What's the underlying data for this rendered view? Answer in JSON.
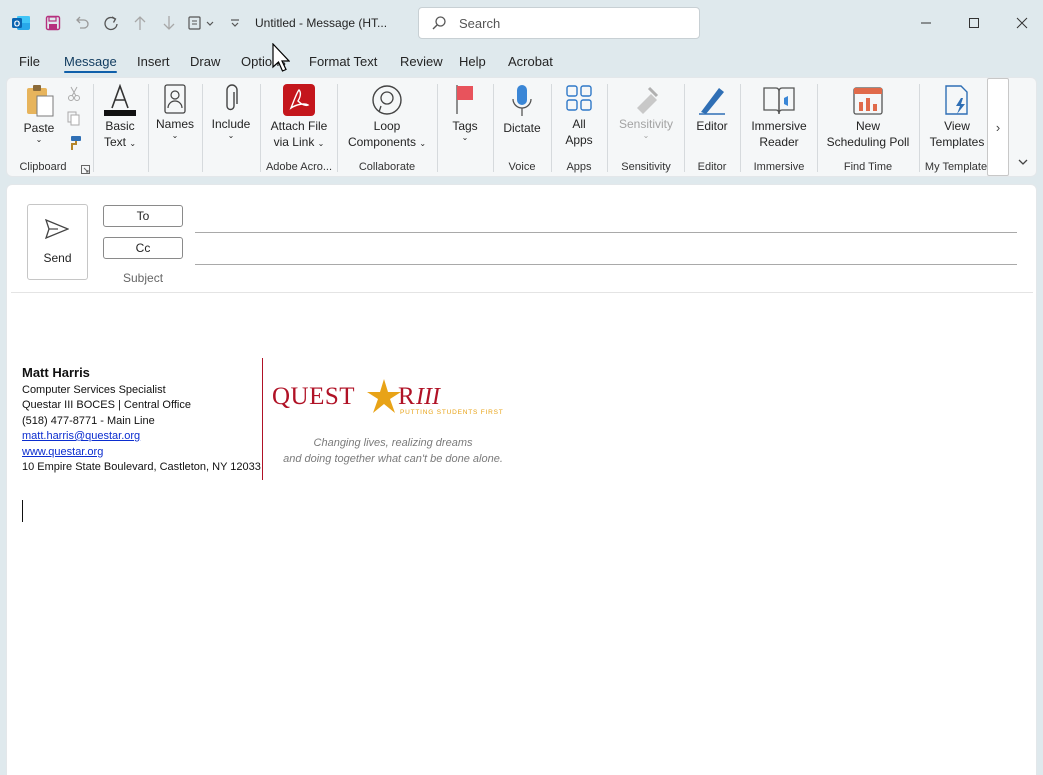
{
  "titlebar": {
    "title": "Untitled  -  Message (HT...",
    "search_placeholder": "Search"
  },
  "menu": {
    "tabs": [
      "File",
      "Message",
      "Insert",
      "Draw",
      "Options",
      "Format Text",
      "Review",
      "Help",
      "Acrobat"
    ],
    "active": "Message"
  },
  "ribbon": {
    "paste": "Paste",
    "basic_text_1": "Basic",
    "basic_text_2": "Text",
    "names": "Names",
    "include": "Include",
    "attach_1": "Attach File",
    "attach_2": "via Link",
    "loop_1": "Loop",
    "loop_2": "Components",
    "tags": "Tags",
    "dictate": "Dictate",
    "all_apps_1": "All",
    "all_apps_2": "Apps",
    "sensitivity": "Sensitivity",
    "editor": "Editor",
    "immersive_1": "Immersive",
    "immersive_2": "Reader",
    "poll_1": "New",
    "poll_2": "Scheduling Poll",
    "templates_1": "View",
    "templates_2": "Templates",
    "groups": {
      "clipboard": "Clipboard",
      "adobe": "Adobe Acro...",
      "collaborate": "Collaborate",
      "voice": "Voice",
      "apps": "Apps",
      "sensitivity": "Sensitivity",
      "editor": "Editor",
      "immersive": "Immersive",
      "find_time": "Find Time",
      "my_templates": "My Template"
    }
  },
  "compose": {
    "send": "Send",
    "to": "To",
    "cc": "Cc",
    "subject": "Subject"
  },
  "signature": {
    "name": "Matt Harris",
    "title": "Computer Services Specialist",
    "org": "Questar III BOCES | Central Office",
    "phone": "(518) 477-8771 - Main Line",
    "email": "matt.harris@questar.org",
    "web": "www.questar.org",
    "address": "10 Empire State Boulevard, Castleton, NY 12033",
    "logo_text": "QUESTAR III",
    "logo_sub": "PUTTING STUDENTS FIRST",
    "tagline_1": "Changing lives, realizing dreams",
    "tagline_2": "and doing together what can't be done alone."
  },
  "colors": {
    "accent": "#0f5faa",
    "adobe_red": "#c4161c",
    "questar_red": "#b01226",
    "questar_gold": "#e8a317"
  }
}
